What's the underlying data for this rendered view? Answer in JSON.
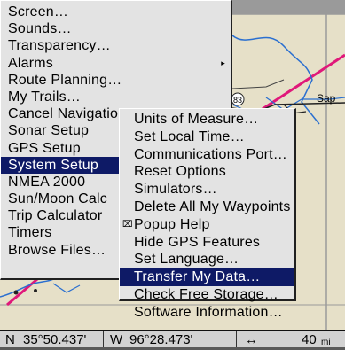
{
  "main_menu": {
    "items": [
      {
        "label": "Screen…",
        "submenu": false
      },
      {
        "label": "Sounds…",
        "submenu": false
      },
      {
        "label": "Transparency…",
        "submenu": false
      },
      {
        "label": "Alarms",
        "submenu": true
      },
      {
        "label": "Route Planning…",
        "submenu": false
      },
      {
        "label": "My Trails…",
        "submenu": false
      },
      {
        "label": "Cancel Navigation",
        "submenu": false
      },
      {
        "label": "Sonar Setup",
        "submenu": false
      },
      {
        "label": "GPS Setup",
        "submenu": false
      },
      {
        "label": "System Setup",
        "submenu": true
      },
      {
        "label": "NMEA 2000",
        "submenu": false
      },
      {
        "label": "Sun/Moon Calc",
        "submenu": false
      },
      {
        "label": "Trip Calculator",
        "submenu": false
      },
      {
        "label": "Timers",
        "submenu": false
      },
      {
        "label": "Browse Files…",
        "submenu": false
      }
    ],
    "selected_index": 9
  },
  "sub_menu": {
    "items": [
      {
        "label": "Units of Measure…",
        "checked": false
      },
      {
        "label": "Set Local Time…",
        "checked": false
      },
      {
        "label": "Communications Port…",
        "checked": false
      },
      {
        "label": "Reset Options",
        "checked": false
      },
      {
        "label": "Simulators…",
        "checked": false
      },
      {
        "label": "Delete All My Waypoints",
        "checked": false
      },
      {
        "label": "Popup Help",
        "checked": true
      },
      {
        "label": "Hide GPS Features",
        "checked": false
      },
      {
        "label": "Set Language…",
        "checked": false
      },
      {
        "label": "Transfer My Data…",
        "checked": false
      },
      {
        "label": "Check Free Storage…",
        "checked": false
      },
      {
        "label": "Software Information…",
        "checked": false
      }
    ],
    "selected_index": 9
  },
  "map": {
    "labels": {
      "highway_number": "83",
      "town": "Sap"
    }
  },
  "status_bar": {
    "lat_dir": "N",
    "lat_value": "35°50.437'",
    "lon_dir": "W",
    "lon_value": "96°28.473'",
    "scale_icon": "horizontal-arrows-icon",
    "scale_value": "40",
    "scale_units": "mi"
  },
  "colors": {
    "menu_background": "#e3e3e3",
    "selected_background": "#0e1a66",
    "selected_text": "#ffffff",
    "map_background": "#e6e0c8",
    "route_line": "#e0187a",
    "road_line": "#2a6fd0"
  }
}
